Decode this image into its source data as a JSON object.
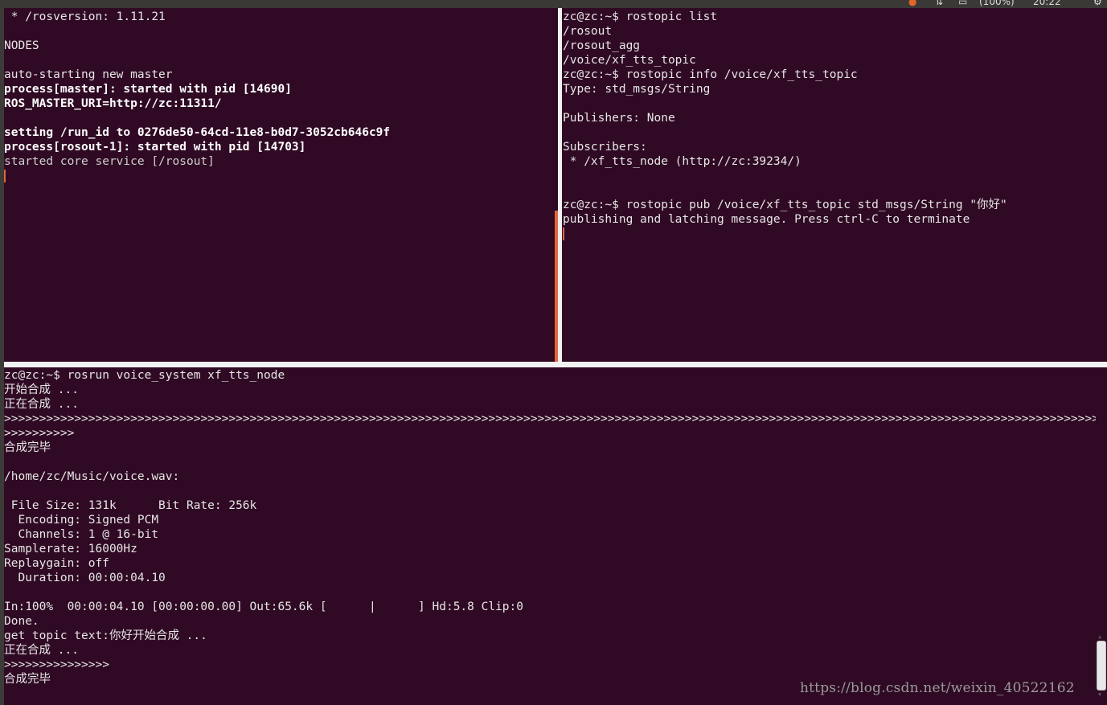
{
  "topbar": {
    "battery": "(100%)",
    "clock": "20:22"
  },
  "pane_top_left": {
    "lines": [
      {
        "text": " * /rosversion: 1.11.21",
        "style": ""
      },
      {
        "text": "",
        "style": ""
      },
      {
        "text": "NODES",
        "style": ""
      },
      {
        "text": "",
        "style": ""
      },
      {
        "text": "auto-starting new master",
        "style": ""
      },
      {
        "text": "process[master]: started with pid [14690]",
        "style": "bold"
      },
      {
        "text": "ROS_MASTER_URI=http://zc:11311/",
        "style": "bold"
      },
      {
        "text": "",
        "style": ""
      },
      {
        "text": "setting /run_id to 0276de50-64cd-11e8-b0d7-3052cb646c9f",
        "style": "bold"
      },
      {
        "text": "process[rosout-1]: started with pid [14703]",
        "style": "bold"
      },
      {
        "text": "started core service [/rosout]",
        "style": "dim"
      }
    ]
  },
  "pane_top_right": {
    "lines": [
      "zc@zc:~$ rostopic list",
      "/rosout",
      "/rosout_agg",
      "/voice/xf_tts_topic",
      "zc@zc:~$ rostopic info /voice/xf_tts_topic",
      "Type: std_msgs/String",
      "",
      "Publishers: None",
      "",
      "Subscribers:",
      " * /xf_tts_node (http://zc:39234/)",
      "",
      "",
      "zc@zc:~$ rostopic pub /voice/xf_tts_topic std_msgs/String \"你好\"",
      "publishing and latching message. Press ctrl-C to terminate"
    ]
  },
  "pane_bottom": {
    "lines": [
      "zc@zc:~$ rosrun voice_system xf_tts_node",
      "开始合成 ...",
      "正在合成 ...",
      ">>>>>>>>>>>>>>>>>>>>>>>>>>>>>>>>>>>>>>>>>>>>>>>>>>>>>>>>>>>>>>>>>>>>>>>>>>>>>>>>>>>>>>>>>>>>>>>>>>>>>>>>>>>>>>>>>>>>>>>>>>>>>>>>>>>>>>>>>>>>>>>>>>>>>>>>>>>>>>>>>>>>>>>>>",
      ">>>>>>>>>>",
      "合成完毕",
      "",
      "/home/zc/Music/voice.wav:",
      "",
      " File Size: 131k      Bit Rate: 256k",
      "  Encoding: Signed PCM",
      "  Channels: 1 @ 16-bit",
      "Samplerate: 16000Hz",
      "Replaygain: off",
      "  Duration: 00:00:04.10",
      "",
      "In:100%  00:00:04.10 [00:00:00.00] Out:65.6k [      |      ] Hd:5.8 Clip:0",
      "Done.",
      "get topic text:你好开始合成 ...",
      "正在合成 ...",
      ">>>>>>>>>>>>>>>",
      "合成完毕"
    ]
  },
  "watermark": "https://blog.csdn.net/weixin_40522162"
}
